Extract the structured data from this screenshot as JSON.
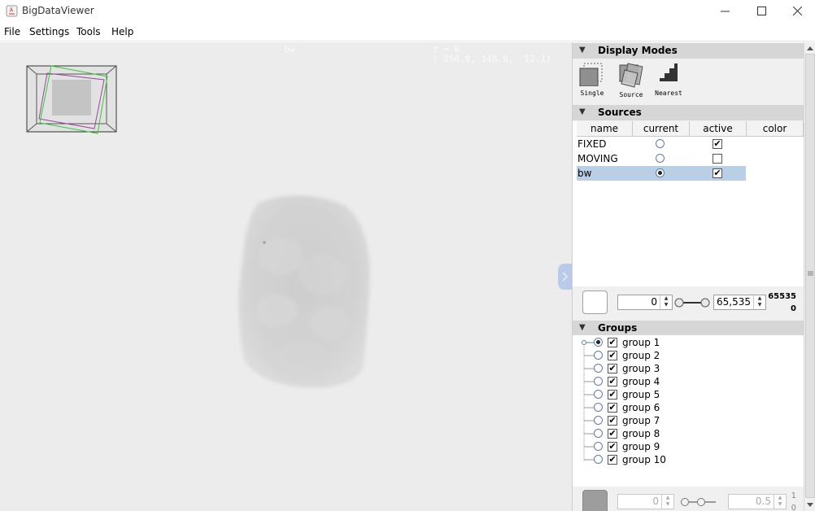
{
  "window": {
    "title": "BigDataViewer"
  },
  "menu": [
    "File",
    "Settings",
    "Tools",
    "Help"
  ],
  "viewer": {
    "source_name": "bw",
    "timepoint": "t = 0",
    "coordinates": "( 256.9, 148.9,  12.1)"
  },
  "display_modes": {
    "header": "Display Modes",
    "modes": [
      {
        "label": "Single",
        "icon": "single-mode-icon"
      },
      {
        "label": "Source",
        "icon": "source-mode-icon"
      },
      {
        "label": "Nearest",
        "icon": "nearest-interpolation-icon"
      }
    ]
  },
  "sources": {
    "header": "Sources",
    "columns": [
      "name",
      "current",
      "active",
      "color"
    ],
    "rows": [
      {
        "name": "FIXED",
        "current": false,
        "active": true,
        "selected": false
      },
      {
        "name": "MOVING",
        "current": false,
        "active": false,
        "selected": false
      },
      {
        "name": "bw",
        "current": true,
        "active": true,
        "selected": true
      }
    ]
  },
  "range": {
    "min_value": "0",
    "max_value": "65,535",
    "range_max": "65535",
    "range_min": "0"
  },
  "groups": {
    "header": "Groups",
    "items": [
      {
        "label": "group 1",
        "current": true,
        "active": true
      },
      {
        "label": "group 2",
        "current": false,
        "active": true
      },
      {
        "label": "group 3",
        "current": false,
        "active": true
      },
      {
        "label": "group 4",
        "current": false,
        "active": true
      },
      {
        "label": "group 5",
        "current": false,
        "active": true
      },
      {
        "label": "group 6",
        "current": false,
        "active": true
      },
      {
        "label": "group 7",
        "current": false,
        "active": true
      },
      {
        "label": "group 8",
        "current": false,
        "active": true
      },
      {
        "label": "group 9",
        "current": false,
        "active": true
      },
      {
        "label": "group 10",
        "current": false,
        "active": true
      }
    ]
  },
  "group_range": {
    "min_value": "0",
    "max_value": "0.5",
    "range_max": "1",
    "range_min": "0"
  },
  "colors": {
    "viewer_bg": "#ececec",
    "selection": "#b8cfe5",
    "section_header": "#d6d6d6",
    "overview_green": "#33cc33",
    "overview_purple": "#a040a0"
  }
}
